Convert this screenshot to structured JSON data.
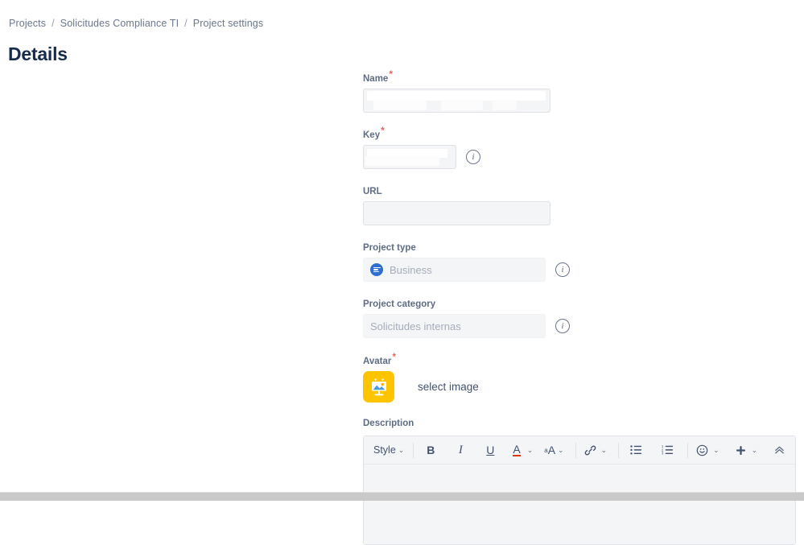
{
  "breadcrumb": {
    "items": [
      {
        "label": "Projects"
      },
      {
        "label": "Solicitudes Compliance TI"
      },
      {
        "label": "Project settings"
      }
    ],
    "separator": "/"
  },
  "page": {
    "title": "Details"
  },
  "form": {
    "name": {
      "label": "Name",
      "required_marker": "*",
      "value": "",
      "redacted": true
    },
    "key": {
      "label": "Key",
      "required_marker": "*",
      "value": "",
      "redacted": true,
      "info_icon": "info-icon",
      "info_glyph": "i"
    },
    "url": {
      "label": "URL",
      "value": "",
      "placeholder": ""
    },
    "project_type": {
      "label": "Project type",
      "value": "Business",
      "icon": "business-project-icon",
      "disabled": true,
      "info_glyph": "i"
    },
    "project_category": {
      "label": "Project category",
      "value": "Solicitudes internas",
      "disabled": true,
      "info_glyph": "i"
    },
    "avatar": {
      "label": "Avatar",
      "required_marker": "*",
      "icon": "image-placeholder-icon",
      "tile_color": "#FFC400",
      "select_link": "select image"
    },
    "description": {
      "label": "Description",
      "body_value": "",
      "toolbar": {
        "style": {
          "label": "Style",
          "caret": "⌄"
        },
        "bold": "B",
        "italic": "I",
        "underline": "U",
        "text_color": {
          "glyph": "A",
          "caret": "⌄",
          "color": "#DE350B"
        },
        "text_style": {
          "small": "a",
          "big": "A",
          "caret": "⌄"
        },
        "link": {
          "icon": "link-icon",
          "caret": "⌄"
        },
        "bullet_list": "bullet-list-icon",
        "numbered_list": "numbered-list-icon",
        "emoji": {
          "icon": "emoji-icon",
          "caret": "⌄"
        },
        "insert": {
          "icon": "plus-icon",
          "caret": "⌄"
        },
        "collapse": "collapse-toolbar-icon"
      }
    }
  },
  "colors": {
    "accent_blue": "#2D6FD0",
    "label_gray": "#5E6C84",
    "required_red": "#DE6B5F",
    "avatar_yellow": "#FFC400",
    "underline_red": "#DE350B",
    "field_bg": "#F4F5F7"
  }
}
